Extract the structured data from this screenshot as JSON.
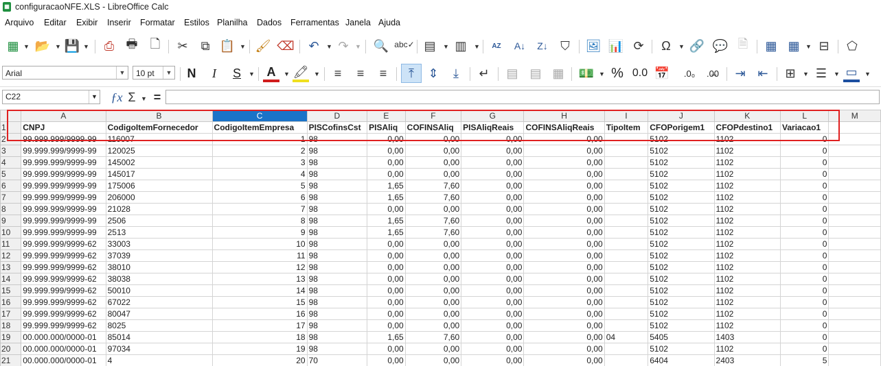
{
  "window": {
    "title": "configuracaoNFE.XLS - LibreOffice Calc",
    "app_icon": "calc-icon"
  },
  "menu": [
    "Arquivo",
    "Editar",
    "Exibir",
    "Inserir",
    "Formatar",
    "Estilos",
    "Planilha",
    "Dados",
    "Ferramentas",
    "Janela",
    "Ajuda"
  ],
  "format": {
    "font_name": "Arial",
    "font_size": "10 pt",
    "percent_symbol": "%",
    "decimal_zero": "0.0"
  },
  "formula_bar": {
    "cell_ref": "C22",
    "content": ""
  },
  "colors": {
    "selection": "#1a73c8",
    "highlight_box": "#e02020"
  },
  "columns": [
    "A",
    "B",
    "C",
    "D",
    "E",
    "F",
    "G",
    "H",
    "I",
    "J",
    "K",
    "L",
    "M"
  ],
  "selected_column": "C",
  "header_row": [
    "CNPJ",
    "CodigoItemFornecedor",
    "CodigoItemEmpresa",
    "PISCofinsCst",
    "PISAliq",
    "COFINSAliq",
    "PISAliqReais",
    "COFINSAliqReais",
    "TipoItem",
    "CFOPorigem1",
    "CFOPdestino1",
    "Variacao1"
  ],
  "rows": [
    [
      "99.999.999/9999-99",
      "116007",
      "1",
      "98",
      "0,00",
      "0,00",
      "0,00",
      "0,00",
      "",
      "5102",
      "1102",
      "0"
    ],
    [
      "99.999.999/9999-99",
      "120025",
      "2",
      "98",
      "0,00",
      "0,00",
      "0,00",
      "0,00",
      "",
      "5102",
      "1102",
      "0"
    ],
    [
      "99.999.999/9999-99",
      "145002",
      "3",
      "98",
      "0,00",
      "0,00",
      "0,00",
      "0,00",
      "",
      "5102",
      "1102",
      "0"
    ],
    [
      "99.999.999/9999-99",
      "145017",
      "4",
      "98",
      "0,00",
      "0,00",
      "0,00",
      "0,00",
      "",
      "5102",
      "1102",
      "0"
    ],
    [
      "99.999.999/9999-99",
      "175006",
      "5",
      "98",
      "1,65",
      "7,60",
      "0,00",
      "0,00",
      "",
      "5102",
      "1102",
      "0"
    ],
    [
      "99.999.999/9999-99",
      "206000",
      "6",
      "98",
      "1,65",
      "7,60",
      "0,00",
      "0,00",
      "",
      "5102",
      "1102",
      "0"
    ],
    [
      "99.999.999/9999-99",
      "21028",
      "7",
      "98",
      "0,00",
      "0,00",
      "0,00",
      "0,00",
      "",
      "5102",
      "1102",
      "0"
    ],
    [
      "99.999.999/9999-99",
      "2506",
      "8",
      "98",
      "1,65",
      "7,60",
      "0,00",
      "0,00",
      "",
      "5102",
      "1102",
      "0"
    ],
    [
      "99.999.999/9999-99",
      "2513",
      "9",
      "98",
      "1,65",
      "7,60",
      "0,00",
      "0,00",
      "",
      "5102",
      "1102",
      "0"
    ],
    [
      "99.999.999/9999-62",
      "33003",
      "10",
      "98",
      "0,00",
      "0,00",
      "0,00",
      "0,00",
      "",
      "5102",
      "1102",
      "0"
    ],
    [
      "99.999.999/9999-62",
      "37039",
      "11",
      "98",
      "0,00",
      "0,00",
      "0,00",
      "0,00",
      "",
      "5102",
      "1102",
      "0"
    ],
    [
      "99.999.999/9999-62",
      "38010",
      "12",
      "98",
      "0,00",
      "0,00",
      "0,00",
      "0,00",
      "",
      "5102",
      "1102",
      "0"
    ],
    [
      "99.999.999/9999-62",
      "38038",
      "13",
      "98",
      "0,00",
      "0,00",
      "0,00",
      "0,00",
      "",
      "5102",
      "1102",
      "0"
    ],
    [
      "99.999.999/9999-62",
      "50010",
      "14",
      "98",
      "0,00",
      "0,00",
      "0,00",
      "0,00",
      "",
      "5102",
      "1102",
      "0"
    ],
    [
      "99.999.999/9999-62",
      "67022",
      "15",
      "98",
      "0,00",
      "0,00",
      "0,00",
      "0,00",
      "",
      "5102",
      "1102",
      "0"
    ],
    [
      "99.999.999/9999-62",
      "80047",
      "16",
      "98",
      "0,00",
      "0,00",
      "0,00",
      "0,00",
      "",
      "5102",
      "1102",
      "0"
    ],
    [
      "99.999.999/9999-62",
      "8025",
      "17",
      "98",
      "0,00",
      "0,00",
      "0,00",
      "0,00",
      "",
      "5102",
      "1102",
      "0"
    ],
    [
      "00.000.000/0000-01",
      "85014",
      "18",
      "98",
      "1,65",
      "7,60",
      "0,00",
      "0,00",
      "04",
      "5405",
      "1403",
      "0"
    ],
    [
      "00.000.000/0000-01",
      "97034",
      "19",
      "98",
      "0,00",
      "0,00",
      "0,00",
      "0,00",
      "",
      "5102",
      "1102",
      "0"
    ],
    [
      "00.000.000/0000-01",
      "4",
      "20",
      "70",
      "0,00",
      "0,00",
      "0,00",
      "0,00",
      "",
      "6404",
      "2403",
      "5"
    ]
  ]
}
